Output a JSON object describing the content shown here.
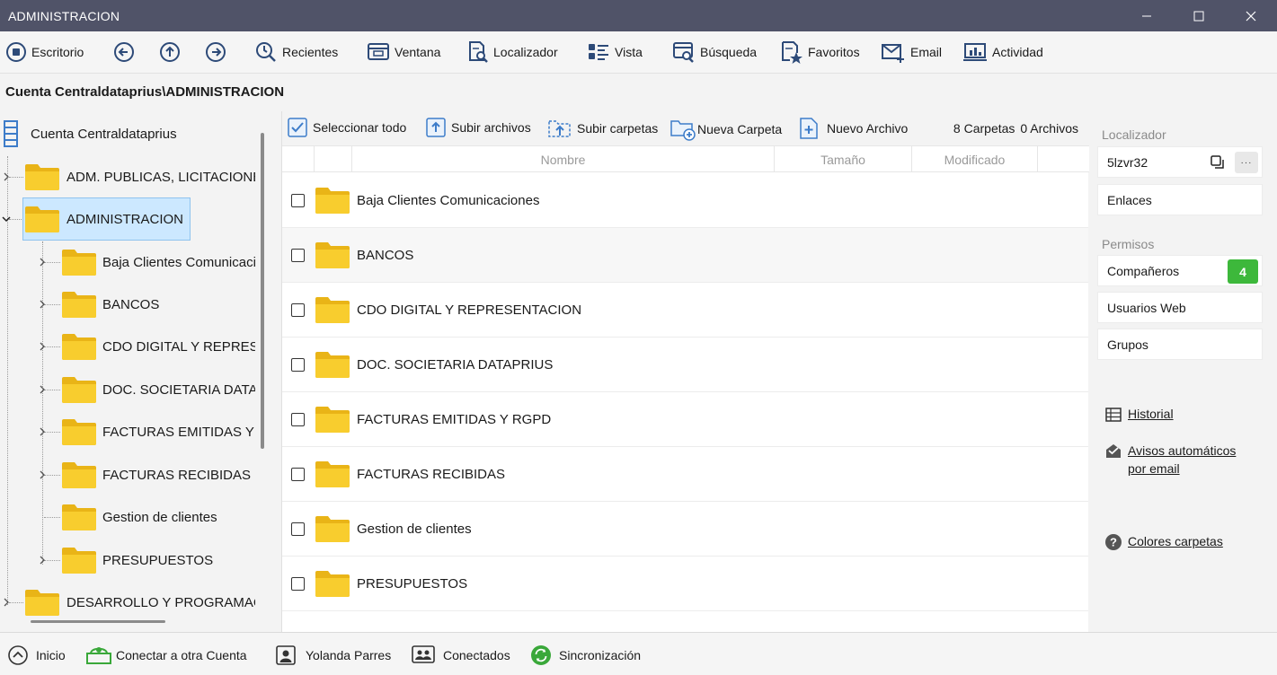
{
  "window": {
    "title": "ADMINISTRACION"
  },
  "toolbar": {
    "escritorio": "Escritorio",
    "recientes": "Recientes",
    "ventana": "Ventana",
    "localizador": "Localizador",
    "vista": "Vista",
    "busqueda": "Búsqueda",
    "favoritos": "Favoritos",
    "email": "Email",
    "actividad": "Actividad"
  },
  "breadcrumb": "Cuenta Centraldataprius\\ADMINISTRACION",
  "tree": {
    "root": "Cuenta Centraldataprius",
    "items": [
      {
        "label": "ADM. PUBLICAS, LICITACIONES"
      },
      {
        "label": "ADMINISTRACION"
      },
      {
        "label": "Baja Clientes Comunicaciones"
      },
      {
        "label": "BANCOS"
      },
      {
        "label": "CDO DIGITAL Y REPRESENTACION"
      },
      {
        "label": "DOC. SOCIETARIA DATAPRIUS"
      },
      {
        "label": "FACTURAS EMITIDAS Y RGPD"
      },
      {
        "label": "FACTURAS RECIBIDAS"
      },
      {
        "label": "Gestion de clientes"
      },
      {
        "label": "PRESUPUESTOS"
      },
      {
        "label": "DESARROLLO Y PROGRAMACION"
      }
    ]
  },
  "actions": {
    "select_all": "Seleccionar todo",
    "upload_files": "Subir archivos",
    "upload_folders": "Subir carpetas",
    "new_folder": "Nueva Carpeta",
    "new_file": "Nuevo Archivo",
    "folders_count": "8 Carpetas",
    "files_count": "0 Archivos"
  },
  "columns": {
    "name": "Nombre",
    "size": "Tamaño",
    "modified": "Modificado"
  },
  "files": [
    {
      "name": "Baja Clientes Comunicaciones"
    },
    {
      "name": "BANCOS"
    },
    {
      "name": "CDO DIGITAL Y REPRESENTACION"
    },
    {
      "name": "DOC. SOCIETARIA DATAPRIUS"
    },
    {
      "name": "FACTURAS EMITIDAS Y RGPD"
    },
    {
      "name": "FACTURAS RECIBIDAS"
    },
    {
      "name": "Gestion de clientes"
    },
    {
      "name": "PRESUPUESTOS"
    }
  ],
  "right": {
    "localizador_title": "Localizador",
    "localizador_value": "5lzvr32",
    "more_label": "···",
    "enlaces": "Enlaces",
    "permisos_title": "Permisos",
    "companeros": "Compañeros",
    "companeros_count": "4",
    "usuarios_web": "Usuarios Web",
    "grupos": "Grupos",
    "historial": "Historial",
    "avisos_line1": "Avisos automáticos",
    "avisos_line2": "por email",
    "colores": "Colores carpetas"
  },
  "status": {
    "inicio": "Inicio",
    "conectar": "Conectar a otra Cuenta",
    "user": "Yolanda Parres",
    "conectados": "Conectados",
    "sync": "Sincronización"
  },
  "colors": {
    "titlebar": "#505368",
    "folder": "#f6c62b",
    "folder_tab": "#e9b417",
    "accent": "#3d7cc9",
    "badge": "#3db83b",
    "green": "#3aa83a"
  }
}
